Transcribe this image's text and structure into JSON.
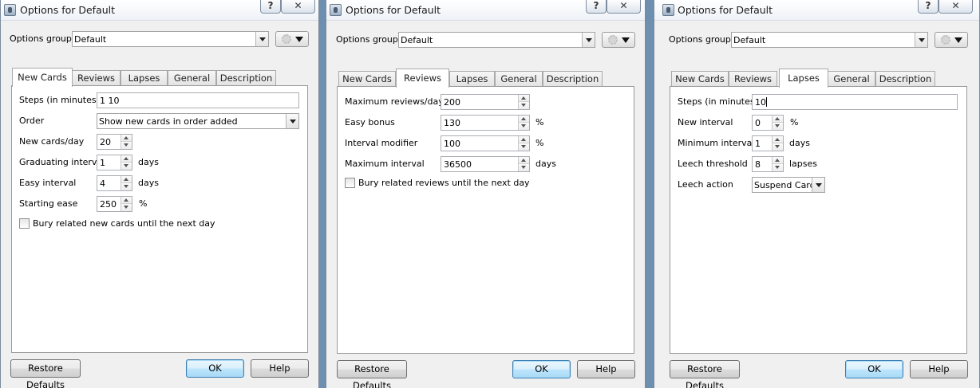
{
  "window_title": "Options for Default",
  "caption_help": "?",
  "caption_close": "✕",
  "options_group_label": "Options group:",
  "options_group_value": "Default",
  "tabs": [
    "New Cards",
    "Reviews",
    "Lapses",
    "General",
    "Description"
  ],
  "buttons": {
    "restore": "Restore Defaults",
    "ok": "OK",
    "help": "Help"
  },
  "new_cards": {
    "steps_label": "Steps (in minutes)",
    "steps_value": "1 10",
    "order_label": "Order",
    "order_value": "Show new cards in order added",
    "per_day_label": "New cards/day",
    "per_day_value": "20",
    "graduating_label": "Graduating interval",
    "graduating_value": "1",
    "graduating_unit": "days",
    "easy_label": "Easy interval",
    "easy_value": "4",
    "easy_unit": "days",
    "ease_label": "Starting ease",
    "ease_value": "250",
    "ease_unit": "%",
    "bury_label": "Bury related new cards until the next day"
  },
  "reviews": {
    "max_label": "Maximum reviews/day",
    "max_value": "200",
    "easy_bonus_label": "Easy bonus",
    "easy_bonus_value": "130",
    "easy_bonus_unit": "%",
    "modifier_label": "Interval modifier",
    "modifier_value": "100",
    "modifier_unit": "%",
    "max_interval_label": "Maximum interval",
    "max_interval_value": "36500",
    "max_interval_unit": "days",
    "bury_label": "Bury related reviews until the next day"
  },
  "lapses": {
    "steps_label": "Steps (in minutes)",
    "steps_value": "10",
    "new_interval_label": "New interval",
    "new_interval_value": "0",
    "new_interval_unit": "%",
    "min_interval_label": "Minimum interval",
    "min_interval_value": "1",
    "min_interval_unit": "days",
    "leech_threshold_label": "Leech threshold",
    "leech_threshold_value": "8",
    "leech_threshold_unit": "lapses",
    "leech_action_label": "Leech action",
    "leech_action_value": "Suspend Card"
  }
}
